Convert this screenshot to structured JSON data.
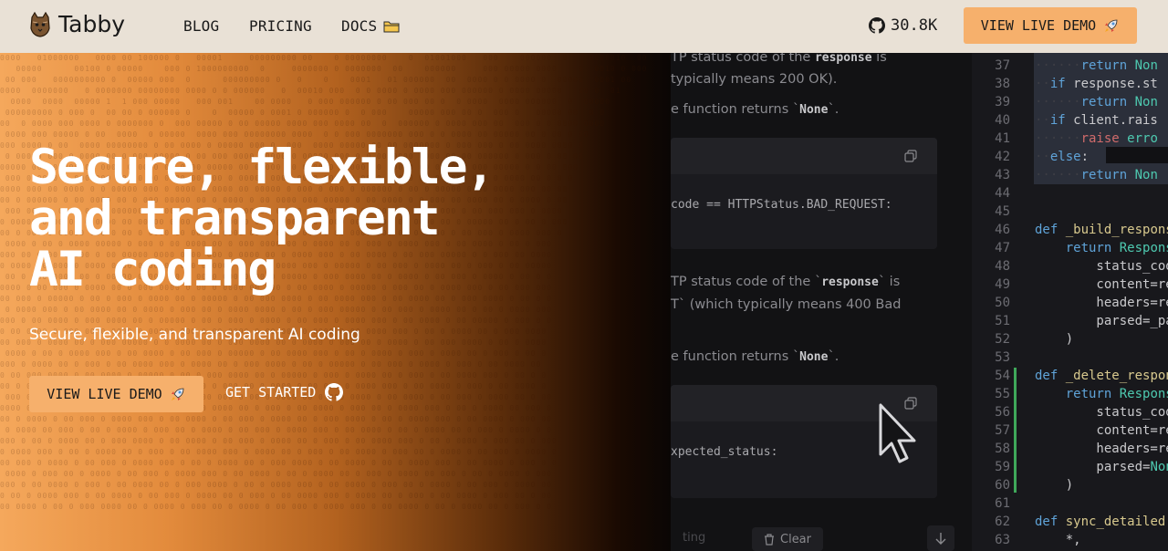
{
  "nav": {
    "brand": "Tabby",
    "links": [
      "BLOG",
      "PRICING",
      "DOCS"
    ],
    "github_stars": "30.8K",
    "demo_label": "VIEW LIVE DEMO"
  },
  "hero": {
    "headline_1": "Secure, flexible,",
    "headline_2": "and transparent",
    "headline_3": "AI coding",
    "subheadline": "Secure, flexible, and transparent AI coding",
    "primary_cta": "VIEW LIVE DEMO",
    "secondary_cta": "GET STARTED"
  },
  "chat": {
    "p1a": "TP status code of the ",
    "p1b": "response",
    "p1c": " is",
    "p2": "typically means 200 OK).",
    "p3a": "e function returns ",
    "p3b": "None",
    "p3c": ".",
    "code1": "code == HTTPStatus.BAD_REQUEST:",
    "p4a": "TP status code of the ",
    "p4b": "response",
    "p4c": " is",
    "p5": "T` (which typically means 400 Bad",
    "p6a": "e function returns ",
    "p6b": "None",
    "p6c": ".",
    "code2": "xpected_status:",
    "faded": "ting",
    "clear": "Clear"
  },
  "editor": {
    "line_numbers": [
      "37",
      "38",
      "39",
      "40",
      "41",
      "42",
      "43",
      "44",
      "45",
      "46",
      "47",
      "48",
      "49",
      "50",
      "51",
      "52",
      "53",
      "54",
      "55",
      "56",
      "57",
      "58",
      "59",
      "60",
      "61",
      "62",
      "63"
    ]
  },
  "colors": {
    "nav_bg": "#e9e1d6",
    "accent": "#f6b06c",
    "git_added": "#3fa85a"
  }
}
